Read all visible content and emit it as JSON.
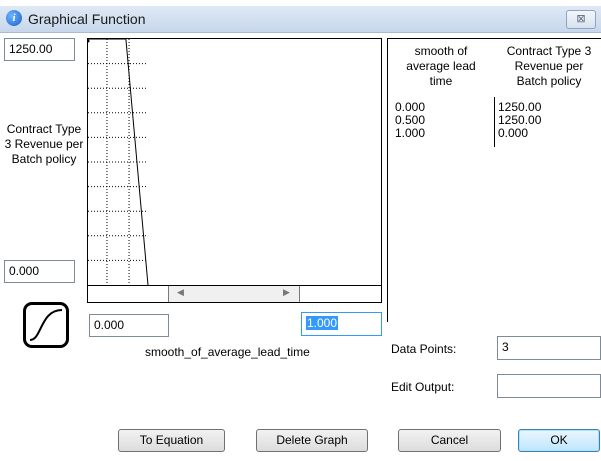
{
  "window": {
    "title": "Graphical Function",
    "icon": "info-icon",
    "close_glyph": "⊠"
  },
  "graph": {
    "y_max": "1250.00",
    "y_min": "0.000",
    "y_label": "Contract Type 3 Revenue per Batch policy",
    "x_min": "0.000",
    "x_max": "1.000",
    "x_label": "smooth_of_average_lead_time"
  },
  "table": {
    "col_input": "smooth of average lead time",
    "col_output": "Contract Type 3 Revenue per Batch policy",
    "rows": [
      {
        "input": "0.000",
        "output": "1250.00"
      },
      {
        "input": "0.500",
        "output": "1250.00"
      },
      {
        "input": "1.000",
        "output": "0.000"
      }
    ]
  },
  "data_points": {
    "label": "Data Points:",
    "value": "3"
  },
  "edit_output": {
    "label": "Edit Output:",
    "value": ""
  },
  "buttons": {
    "to_equation": "To Equation",
    "delete_graph": "Delete Graph",
    "cancel": "Cancel",
    "ok": "OK"
  },
  "chart_data": {
    "type": "line",
    "x": [
      0.0,
      0.5,
      1.0
    ],
    "y": [
      1250.0,
      1250.0,
      0.0
    ],
    "xlabel": "smooth_of_average_lead_time",
    "ylabel": "Contract Type 3 Revenue per Batch policy",
    "ylim": [
      0,
      1250
    ],
    "xlim": [
      0,
      1
    ],
    "grid": true,
    "visible_x_range": [
      0,
      0.19
    ]
  }
}
